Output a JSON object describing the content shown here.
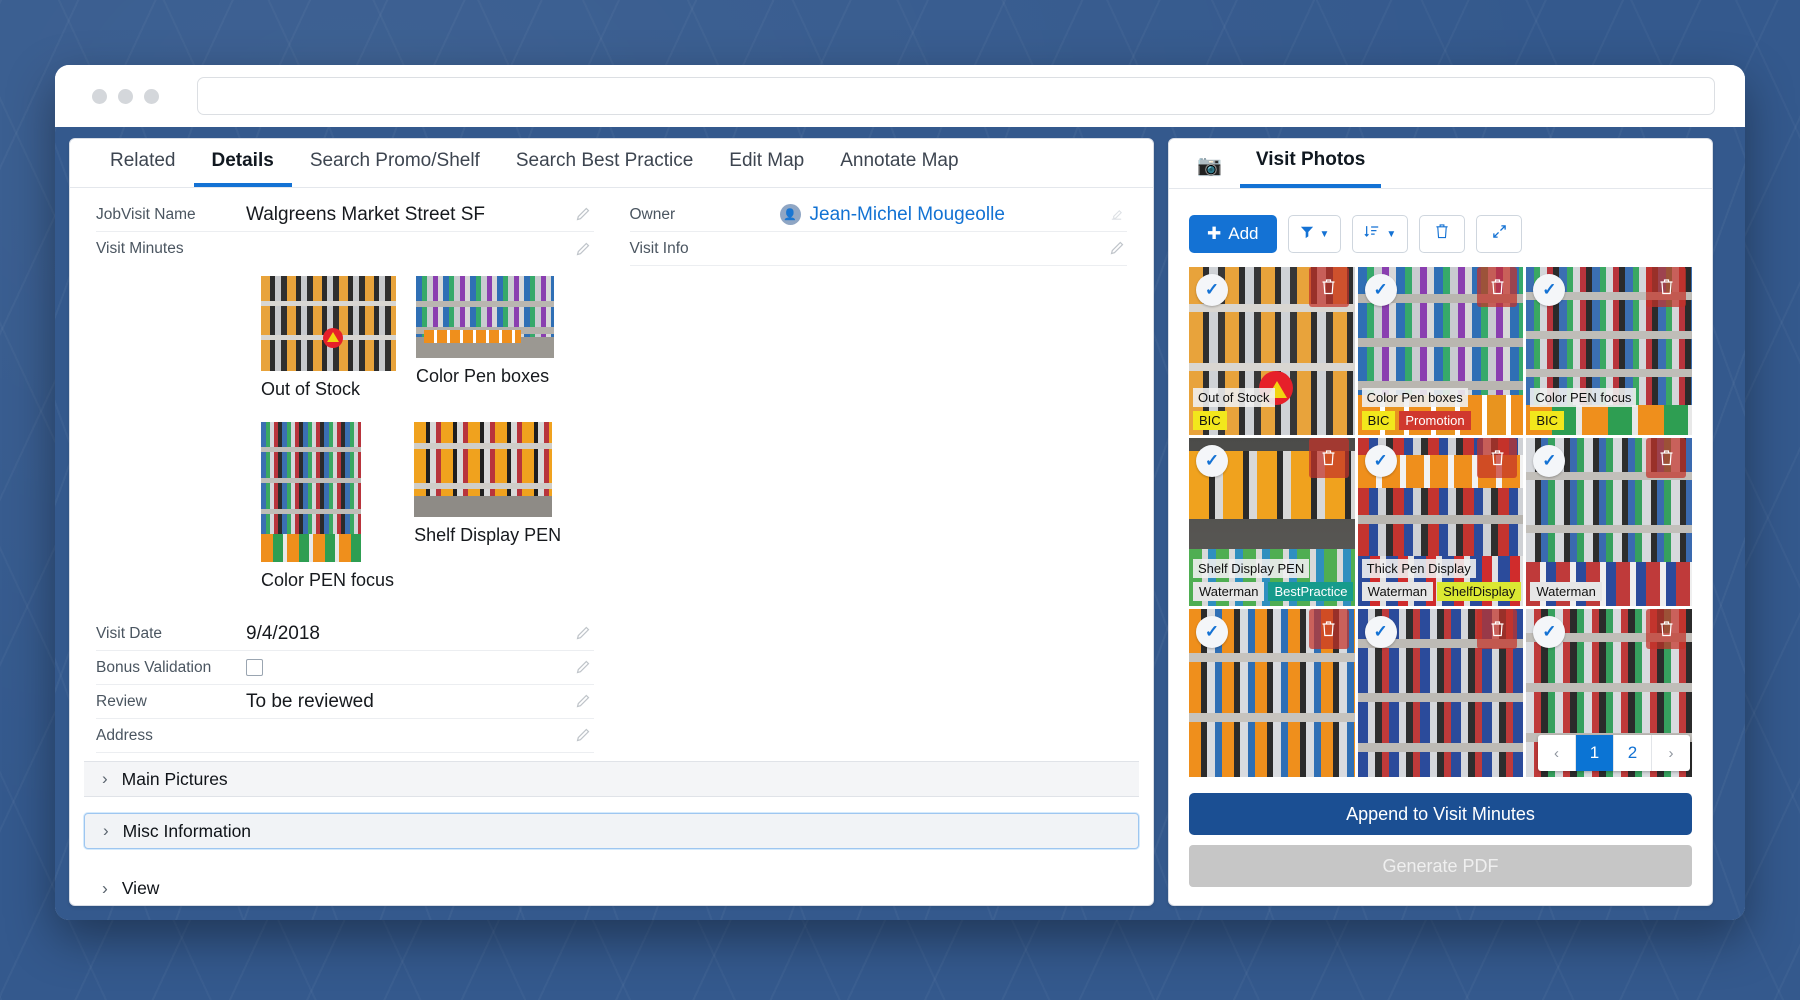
{
  "window": {
    "url_value": "",
    "url_placeholder": ""
  },
  "left_panel": {
    "tabs": [
      {
        "label": "Related",
        "active": false
      },
      {
        "label": "Details",
        "active": true
      },
      {
        "label": "Search Promo/Shelf",
        "active": false
      },
      {
        "label": "Search Best Practice",
        "active": false
      },
      {
        "label": "Edit Map",
        "active": false
      },
      {
        "label": "Annotate Map",
        "active": false
      }
    ],
    "fields": {
      "jobvisit_name_label": "JobVisit Name",
      "jobvisit_name_value": "Walgreens Market Street SF",
      "visit_minutes_label": "Visit Minutes",
      "owner_label": "Owner",
      "owner_value": "Jean-Michel Mougeolle",
      "visit_info_label": "Visit Info",
      "visit_info_value": "",
      "visit_date_label": "Visit Date",
      "visit_date_value": "9/4/2018",
      "bonus_validation_label": "Bonus Validation",
      "bonus_validation_checked": false,
      "review_label": "Review",
      "review_value": "To be reviewed",
      "address_label": "Address",
      "address_value": ""
    },
    "minutes_photos": [
      {
        "caption": "Out of Stock"
      },
      {
        "caption": "Color Pen boxes"
      },
      {
        "caption": "Color PEN focus"
      },
      {
        "caption": "Shelf Display PEN"
      }
    ],
    "sections": [
      {
        "label": "Main Pictures",
        "focused": false
      },
      {
        "label": "Misc Information",
        "focused": true
      }
    ],
    "view_section": {
      "label": "View"
    }
  },
  "right_panel": {
    "header": {
      "icon": "camera-icon",
      "tab_label": "Visit Photos"
    },
    "toolbar": {
      "add_label": "Add",
      "add_icon": "plus-icon",
      "filter_icon": "funnel-icon",
      "sort_icon": "sort-icon",
      "delete_icon": "trash-icon",
      "expand_icon": "expand-icon"
    },
    "photos": [
      {
        "title": "Out of Stock",
        "tags": [
          {
            "text": "BIC",
            "bg": "#f2e71c",
            "color": "#111111"
          }
        ]
      },
      {
        "title": "Color Pen boxes",
        "tags": [
          {
            "text": "BIC",
            "bg": "#f2e71c",
            "color": "#111111"
          },
          {
            "text": "Promotion",
            "bg": "#d0382e",
            "color": "#ffffff"
          }
        ]
      },
      {
        "title": "Color PEN focus",
        "tags": [
          {
            "text": "BIC",
            "bg": "#f2e71c",
            "color": "#111111"
          }
        ]
      },
      {
        "title": "Shelf Display PEN",
        "tags": [
          {
            "text": "Waterman",
            "bg": "#e6e6e6",
            "color": "#111111"
          },
          {
            "text": "BestPractice",
            "bg": "#169b8c",
            "color": "#ffffff"
          }
        ]
      },
      {
        "title": "Thick Pen Display",
        "tags": [
          {
            "text": "Waterman",
            "bg": "#e6e6e6",
            "color": "#111111"
          },
          {
            "text": "ShelfDisplay",
            "bg": "#dbe832",
            "color": "#111111"
          }
        ]
      },
      {
        "title": "",
        "tags": [
          {
            "text": "Waterman",
            "bg": "#e6e6e6",
            "color": "#111111"
          }
        ]
      },
      {
        "title": "",
        "tags": []
      },
      {
        "title": "",
        "tags": []
      },
      {
        "title": "",
        "tags": []
      }
    ],
    "pagination": {
      "prev": "‹",
      "pages": [
        {
          "label": "1",
          "active": true
        },
        {
          "label": "2",
          "active": false
        }
      ],
      "next": "›"
    },
    "footer": {
      "append_label": "Append to Visit Minutes",
      "generate_label": "Generate PDF"
    }
  },
  "colors": {
    "accent_blue": "#1472d4",
    "dark_blue": "#1b4f93",
    "page_bg": "#34598d"
  }
}
